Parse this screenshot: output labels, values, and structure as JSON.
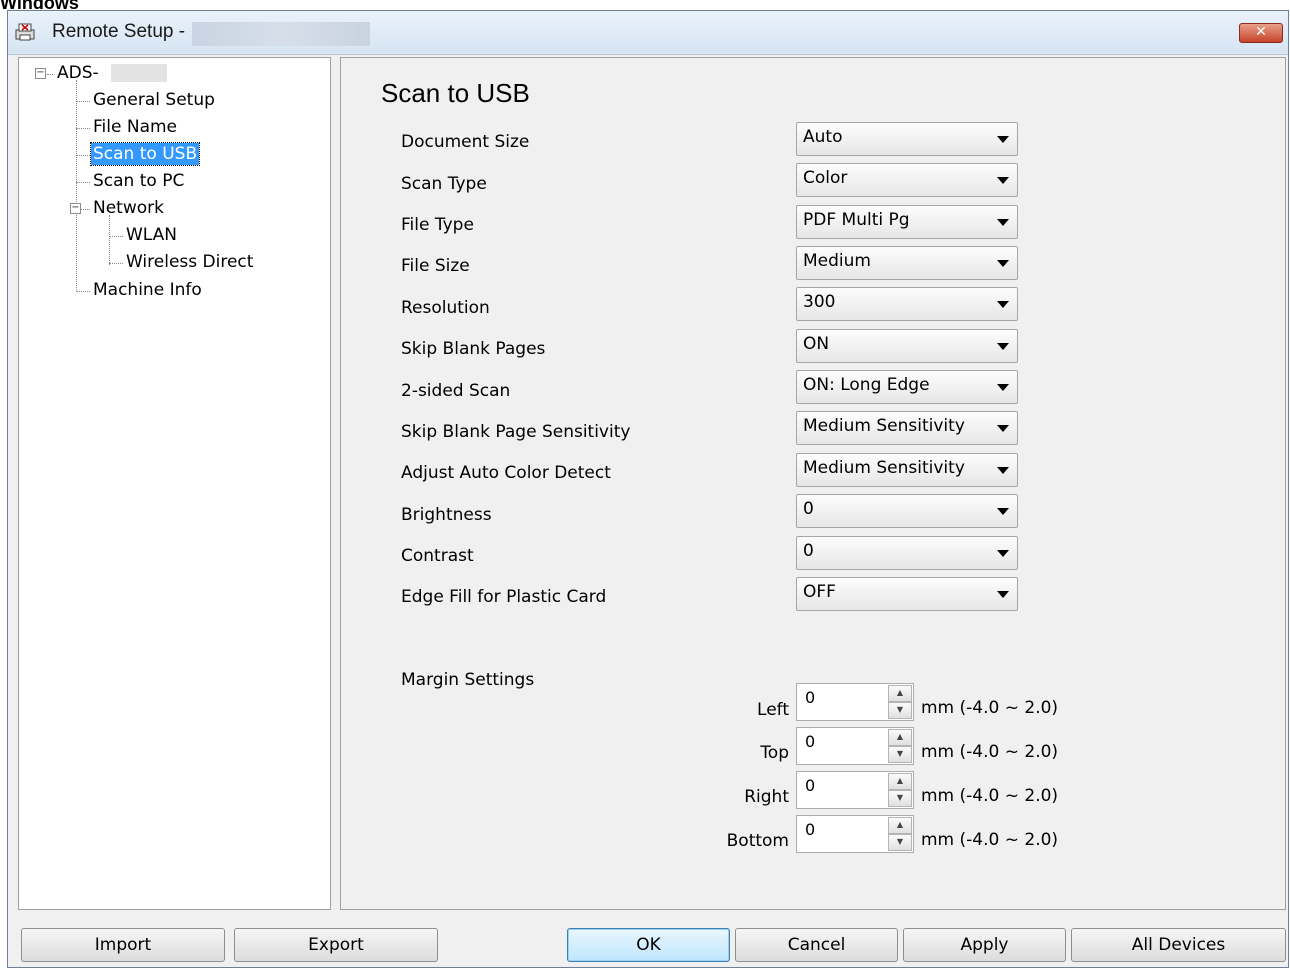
{
  "caption": "Windows",
  "window": {
    "title": "Remote Setup -",
    "close_glyph": "✕"
  },
  "tree": {
    "root": "ADS-",
    "items": [
      {
        "label": "General Setup"
      },
      {
        "label": "File Name"
      },
      {
        "label": "Scan to USB",
        "selected": true
      },
      {
        "label": "Scan to PC"
      },
      {
        "label": "Network"
      },
      {
        "label": "WLAN"
      },
      {
        "label": "Wireless Direct"
      },
      {
        "label": "Machine Info"
      }
    ],
    "collapse_glyph": "−"
  },
  "main": {
    "title": "Scan to USB",
    "fields": [
      {
        "label": "Document Size",
        "value": "Auto"
      },
      {
        "label": "Scan Type",
        "value": "Color"
      },
      {
        "label": "File Type",
        "value": "PDF Multi Pg"
      },
      {
        "label": "File Size",
        "value": "Medium"
      },
      {
        "label": "Resolution",
        "value": "300"
      },
      {
        "label": "Skip Blank Pages",
        "value": "ON"
      },
      {
        "label": "2-sided Scan",
        "value": "ON: Long Edge"
      },
      {
        "label": "Skip Blank Page Sensitivity",
        "value": "Medium Sensitivity"
      },
      {
        "label": "Adjust Auto Color Detect",
        "value": "Medium Sensitivity"
      },
      {
        "label": "Brightness",
        "value": "0"
      },
      {
        "label": "Contrast",
        "value": "0"
      },
      {
        "label": "Edge Fill for Plastic Card",
        "value": "OFF"
      }
    ],
    "margin": {
      "title": "Margin Settings",
      "rows": [
        {
          "label": "Left",
          "value": "0",
          "range": "mm (-4.0 ~ 2.0)"
        },
        {
          "label": "Top",
          "value": "0",
          "range": "mm (-4.0 ~ 2.0)"
        },
        {
          "label": "Right",
          "value": "0",
          "range": "mm (-4.0 ~ 2.0)"
        },
        {
          "label": "Bottom",
          "value": "0",
          "range": "mm (-4.0 ~ 2.0)"
        }
      ]
    }
  },
  "buttons": {
    "import": "Import",
    "export": "Export",
    "ok": "OK",
    "cancel": "Cancel",
    "apply": "Apply",
    "all_devices": "All Devices"
  }
}
